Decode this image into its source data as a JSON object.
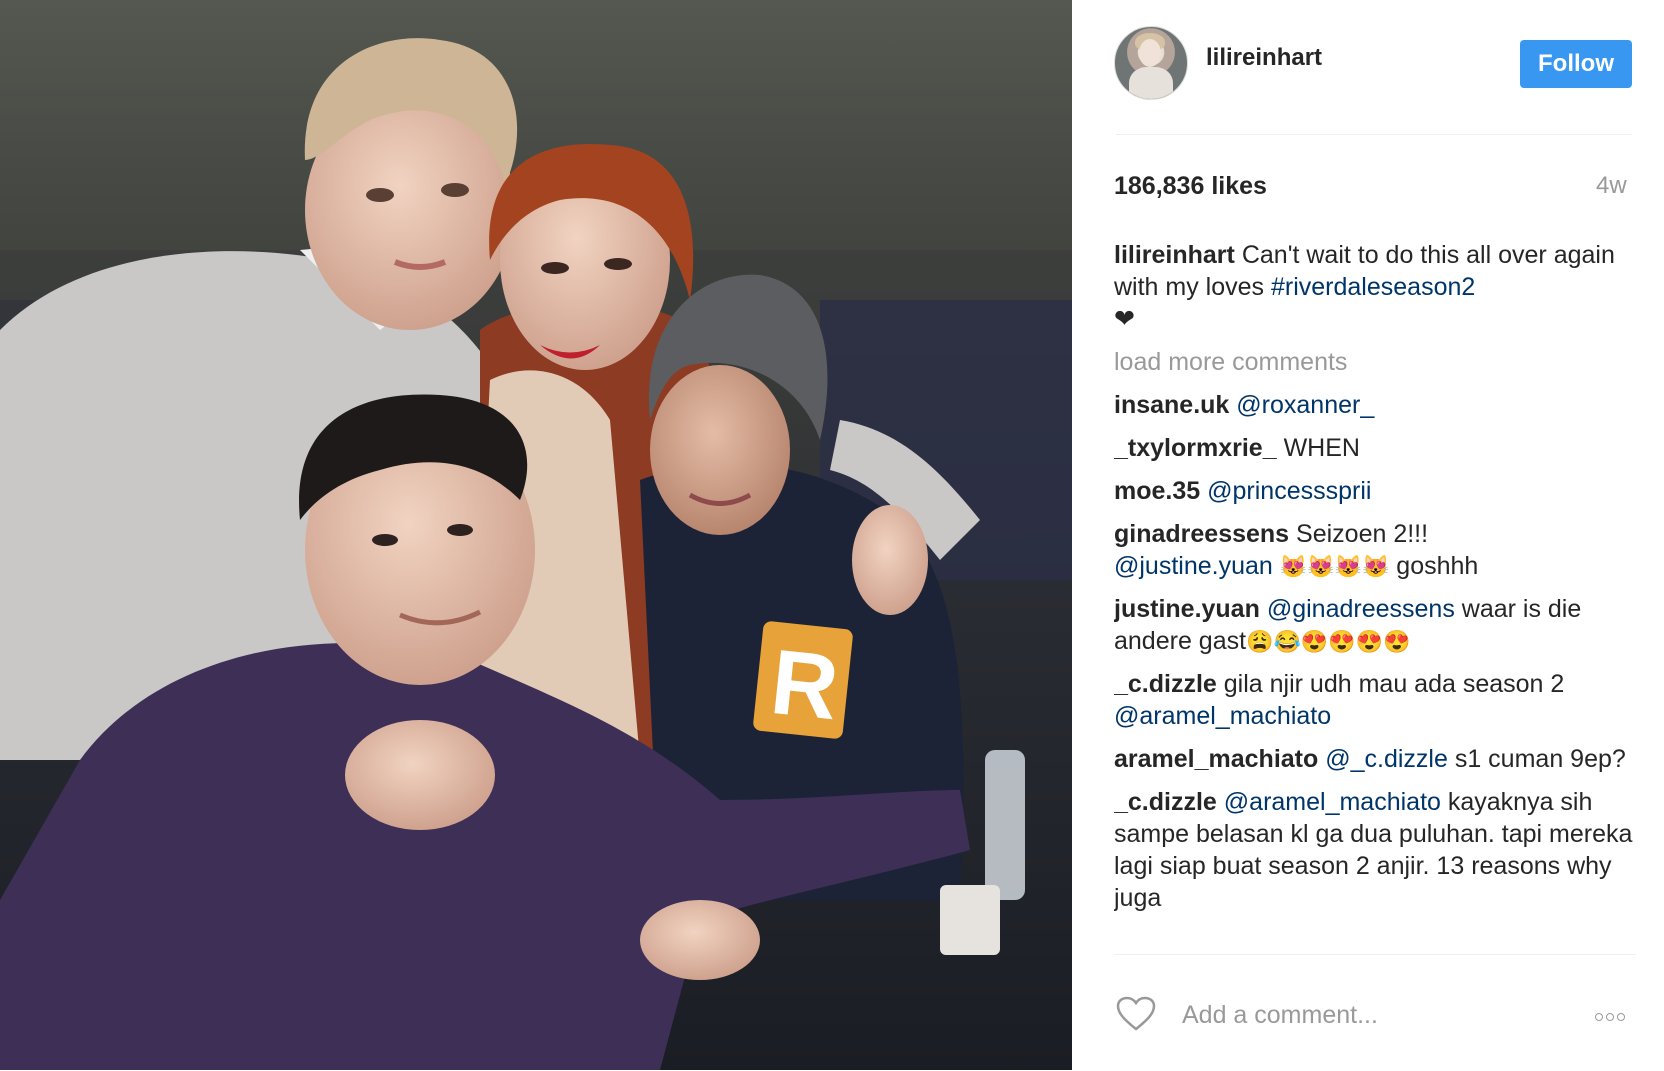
{
  "post": {
    "image": {
      "alt": "",
      "badge_letter": "R"
    },
    "header": {
      "username": "lilireinhart",
      "follow_label": "Follow",
      "avatar_icon": "profile-avatar"
    },
    "likes_text": "186,836 likes",
    "time_ago": "4w",
    "caption": {
      "username": "lilireinhart",
      "text": "Can't wait to do this all over again with my loves ",
      "hashtag": "#riverdaleseason2",
      "emoji": "❤"
    },
    "load_more_label": "load more comments",
    "comments": [
      {
        "user": "insane.uk",
        "mention": "@roxanner_",
        "text": ""
      },
      {
        "user": "_txylormxrie_",
        "mention": "",
        "text": "WHEN"
      },
      {
        "user": "moe.35",
        "mention": "@princesssprii",
        "text": ""
      },
      {
        "user": "ginadreessens",
        "text_before": "Seizoen 2!!! ",
        "mention": "@justine.yuan",
        "emoji": "😻😻😻😻",
        "text": " goshhh"
      },
      {
        "user": "justine.yuan",
        "mention": "@ginadreessens",
        "text": " waar is die andere gast",
        "emoji": "😩😂😍😍😍😍"
      },
      {
        "user": "_c.dizzle",
        "text_before": "gila njir udh mau ada season 2 ",
        "mention": "@aramel_machiato",
        "text": ""
      },
      {
        "user": "aramel_machiato",
        "mention": "@_c.dizzle",
        "text": " s1 cuman 9ep?"
      },
      {
        "user": "_c.dizzle",
        "mention": "@aramel_machiato",
        "text": " kayaknya sih sampe belasan kl ga dua puluhan. tapi mereka lagi siap buat season 2 anjir. 13 reasons why juga"
      }
    ],
    "add_comment_placeholder": "Add a comment...",
    "icons": {
      "like": "heart-outline-icon",
      "more": "more-options-icon"
    },
    "colors": {
      "follow_button": "#3897f0",
      "mention": "#003569",
      "muted": "#999999",
      "text": "#262626"
    }
  }
}
